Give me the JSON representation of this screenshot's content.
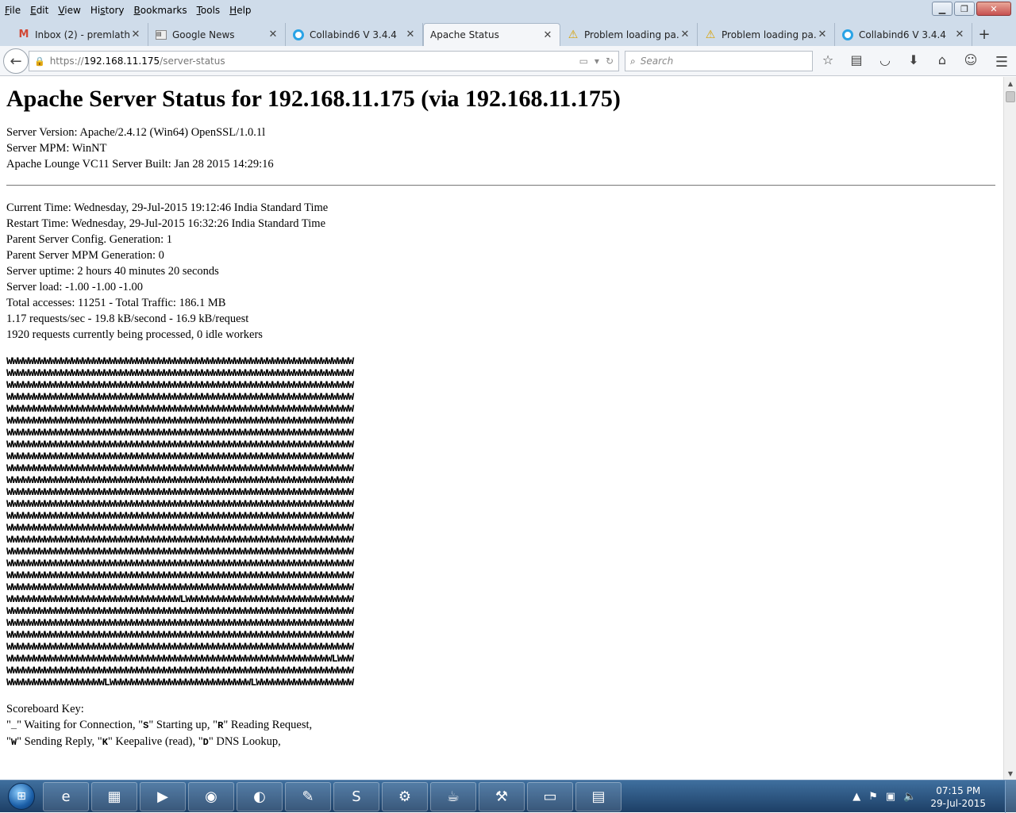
{
  "menu": [
    "File",
    "Edit",
    "View",
    "History",
    "Bookmarks",
    "Tools",
    "Help"
  ],
  "menu_underline": [
    "F",
    "E",
    "V",
    "s",
    "B",
    "T",
    "H"
  ],
  "window_controls": {
    "minimize": "▁",
    "restore": "❐",
    "close": "✕"
  },
  "tabs": [
    {
      "label": "Inbox (2) - premlath...",
      "icon": "gmail-icon",
      "glyph": "M"
    },
    {
      "label": "Google News",
      "icon": "news-icon",
      "glyph": "▤"
    },
    {
      "label": "Collabind6 V 3.4.4",
      "icon": "collab-icon",
      "glyph": ""
    },
    {
      "label": "Apache Status",
      "icon": "",
      "glyph": ""
    },
    {
      "label": "Problem loading pa...",
      "icon": "warn-icon",
      "glyph": "⚠"
    },
    {
      "label": "Problem loading pa...",
      "icon": "warn-icon",
      "glyph": "⚠"
    },
    {
      "label": "Collabind6 V 3.4.4",
      "icon": "collab-icon",
      "glyph": ""
    }
  ],
  "newtab": "+",
  "nav": {
    "back": "←",
    "url_prefix": "https://",
    "url_host": "192.168.11.175",
    "url_path": "/server-status",
    "search_placeholder": "Search"
  },
  "page": {
    "title": "Apache Server Status for 192.168.11.175 (via 192.168.11.175)",
    "server_info": [
      "Server Version: Apache/2.4.12 (Win64) OpenSSL/1.0.1l",
      "Server MPM: WinNT",
      "Apache Lounge VC11 Server Built: Jan 28 2015 14:29:16"
    ],
    "status_info": [
      "Current Time: Wednesday, 29-Jul-2015 19:12:46 India Standard Time",
      "Restart Time: Wednesday, 29-Jul-2015 16:32:26 India Standard Time",
      "Parent Server Config. Generation: 1",
      "Parent Server MPM Generation: 0",
      "Server uptime: 2 hours 40 minutes 20 seconds",
      "Server load: -1.00 -1.00 -1.00",
      "Total accesses: 11251 - Total Traffic: 186.1 MB",
      "1.17 requests/sec - 19.8 kB/second - 16.9 kB/request",
      "1920 requests currently being processed, 0 idle workers"
    ],
    "scoreboard": [
      "WWWWWWWWWWWWWWWWWWWWWWWWWWWWWWWWWWWWWWWWWWWWWWWWWWWWWWWWWWWWWWWW",
      "WWWWWWWWWWWWWWWWWWWWWWWWWWWWWWWWWWWWWWWWWWWWWWWWWWWWWWWWWWWWWWWW",
      "WWWWWWWWWWWWWWWWWWWWWWWWWWWWWWWWWWWWWWWWWWWWWWWWWWWWWWWWWWWWWWWW",
      "WWWWWWWWWWWWWWWWWWWWWWWWWWWWWWWWWWWWWWWWWWWWWWWWWWWWWWWWWWWWWWWW",
      "WWWWWWWWWWWWWWWWWWWWWWWWWWWWWWWWWWWWWWWWWWWWWWWWWWWWWWWWWWWWWWWW",
      "WWWWWWWWWWWWWWWWWWWWWWWWWWWWWWWWWWWWWWWWWWWWWWWWWWWWWWWWWWWWWWWW",
      "WWWWWWWWWWWWWWWWWWWWWWWWWWWWWWWWWWWWWWWWWWWWWWWWWWWWWWWWWWWWWWWW",
      "WWWWWWWWWWWWWWWWWWWWWWWWWWWWWWWWWWWWWWWWWWWWWWWWWWWWWWWWWWWWWWWW",
      "WWWWWWWWWWWWWWWWWWWWWWWWWWWWWWWWWWWWWWWWWWWWWWWWWWWWWWWWWWWWWWWW",
      "WWWWWWWWWWWWWWWWWWWWWWWWWWWWWWWWWWWWWWWWWWWWWWWWWWWWWWWWWWWWWWWW",
      "WWWWWWWWWWWWWWWWWWWWWWWWWWWWWWWWWWWWWWWWWWWWWWWWWWWWWWWWWWWWWWWW",
      "WWWWWWWWWWWWWWWWWWWWWWWWWWWWWWWWWWWWWWWWWWWWWWWWWWWWWWWWWWWWWWWW",
      "WWWWWWWWWWWWWWWWWWWWWWWWWWWWWWWWWWWWWWWWWWWWWWWWWWWWWWWWWWWWWWWW",
      "WWWWWWWWWWWWWWWWWWWWWWWWWWWWWWWWWWWWWWWWWWWWWWWWWWWWWWWWWWWWWWWW",
      "WWWWWWWWWWWWWWWWWWWWWWWWWWWWWWWWWWWWWWWWWWWWWWWWWWWWWWWWWWWWWWWW",
      "WWWWWWWWWWWWWWWWWWWWWWWWWWWWWWWWWWWWWWWWWWWWWWWWWWWWWWWWWWWWWWWW",
      "WWWWWWWWWWWWWWWWWWWWWWWWWWWWWWWWWWWWWWWWWWWWWWWWWWWWWWWWWWWWWWWW",
      "WWWWWWWWWWWWWWWWWWWWWWWWWWWWWWWWWWWWWWWWWWWWWWWWWWWWWWWWWWWWWWWW",
      "WWWWWWWWWWWWWWWWWWWWWWWWWWWWWWWWWWWWWWWWWWWWWWWWWWWWWWWWWWWWWWWW",
      "WWWWWWWWWWWWWWWWWWWWWWWWWWWWWWWWWWWWWWWWWWWWWWWWWWWWWWWWWWWWWWWW",
      "WWWWWWWWWWWWWWWWWWWWWWWWWWWWWWWWLWWWWWWWWWWWWWWWWWWWWWWWWWWWWWWW",
      "WWWWWWWWWWWWWWWWWWWWWWWWWWWWWWWWWWWWWWWWWWWWWWWWWWWWWWWWWWWWWWWW",
      "WWWWWWWWWWWWWWWWWWWWWWWWWWWWWWWWWWWWWWWWWWWWWWWWWWWWWWWWWWWWWWWW",
      "WWWWWWWWWWWWWWWWWWWWWWWWWWWWWWWWWWWWWWWWWWWWWWWWWWWWWWWWWWWWWWWW",
      "WWWWWWWWWWWWWWWWWWWWWWWWWWWWWWWWWWWWWWWWWWWWWWWWWWWWWWWWWWWWWWWW",
      "WWWWWWWWWWWWWWWWWWWWWWWWWWWWWWWWWWWWWWWWWWWWWWWWWWWWWWWWWWWWLWWW",
      "WWWWWWWWWWWWWWWWWWWWWWWWWWWWWWWWWWWWWWWWWWWWWWWWWWWWWWWWWWWWWWWW",
      "WWWWWWWWWWWWWWWWWWLWWWWWWWWWWWWWWWWWWWWWWWWWWLWWWWWWWWWWWWWWWWWW"
    ],
    "key_title": "Scoreboard Key:",
    "key_lines": [
      [
        {
          "t": "\""
        },
        {
          "b": "_"
        },
        {
          "t": "\" Waiting for Connection, \""
        },
        {
          "b": "S"
        },
        {
          "t": "\" Starting up, \""
        },
        {
          "b": "R"
        },
        {
          "t": "\" Reading Request,"
        }
      ],
      [
        {
          "t": "\""
        },
        {
          "b": "W"
        },
        {
          "t": "\" Sending Reply, \""
        },
        {
          "b": "K"
        },
        {
          "t": "\" Keepalive (read), \""
        },
        {
          "b": "D"
        },
        {
          "t": "\" DNS Lookup,"
        }
      ]
    ]
  },
  "taskbar": {
    "apps": [
      {
        "name": "ie",
        "glyph": "e"
      },
      {
        "name": "explorer",
        "glyph": "▦"
      },
      {
        "name": "media",
        "glyph": "▶"
      },
      {
        "name": "chrome",
        "glyph": "◉"
      },
      {
        "name": "firefox",
        "glyph": "◐"
      },
      {
        "name": "notepad",
        "glyph": "✎"
      },
      {
        "name": "skype",
        "glyph": "S"
      },
      {
        "name": "settings",
        "glyph": "⚙"
      },
      {
        "name": "java-ee-ide",
        "glyph": "☕"
      },
      {
        "name": "tool",
        "glyph": "⚒"
      },
      {
        "name": "remote",
        "glyph": "▭"
      },
      {
        "name": "spreadsheet",
        "glyph": "▤"
      }
    ],
    "time": "07:15 PM",
    "date": "29-Jul-2015"
  }
}
